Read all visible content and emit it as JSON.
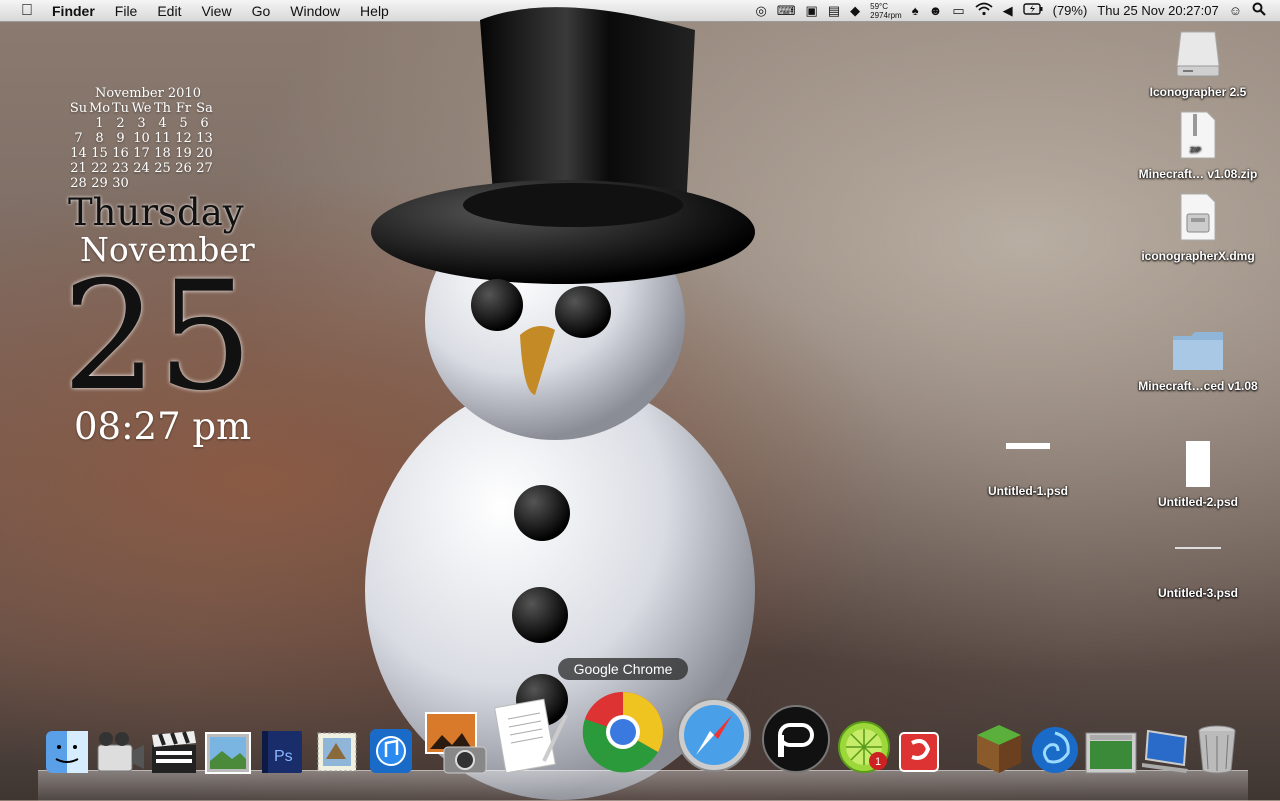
{
  "menubar": {
    "app_name": "Finder",
    "menus": [
      "File",
      "Edit",
      "View",
      "Go",
      "Window",
      "Help"
    ],
    "status": {
      "temperature": "59°C",
      "fan_speed": "2974rpm",
      "battery": "(79%)",
      "datetime": "Thu 25 Nov  20:27:07"
    }
  },
  "widget": {
    "calendar_title": "November 2010",
    "weekday_headers": [
      "Su",
      "Mo",
      "Tu",
      "We",
      "Th",
      "Fr",
      "Sa"
    ],
    "weeks": [
      [
        "",
        "1",
        "2",
        "3",
        "4",
        "5",
        "6"
      ],
      [
        "7",
        "8",
        "9",
        "10",
        "11",
        "12",
        "13"
      ],
      [
        "14",
        "15",
        "16",
        "17",
        "18",
        "19",
        "20"
      ],
      [
        "21",
        "22",
        "23",
        "24",
        "25",
        "26",
        "27"
      ],
      [
        "28",
        "29",
        "30",
        "",
        "",
        "",
        ""
      ]
    ],
    "day_name": "Thursday",
    "month_name": "November",
    "day_number": "25",
    "time": "08:27 pm"
  },
  "desktop_icons": [
    {
      "label": "Iconographer 2.5"
    },
    {
      "label": "Minecraft… v1.08.zip"
    },
    {
      "label": "iconographerX.dmg"
    },
    {
      "label": "Minecraft…ced v1.08"
    },
    {
      "label": "Untitled-1.psd"
    },
    {
      "label": "Untitled-2.psd"
    },
    {
      "label": "Untitled-3.psd"
    }
  ],
  "dock": {
    "tooltip": "Google Chrome",
    "items": [
      "Finder",
      "Front Row",
      "Final Cut",
      "iPhoto Slideshow",
      "Photoshop",
      "Mail",
      "iTunes",
      "Photo Booth",
      "TextEdit",
      "Google Chrome",
      "Safari",
      "Pidgin",
      "LimeWire",
      "Comic",
      "Minecraft",
      "Spaces",
      "Preview",
      "Screen Sharing",
      "Trash"
    ],
    "badge": "1"
  }
}
